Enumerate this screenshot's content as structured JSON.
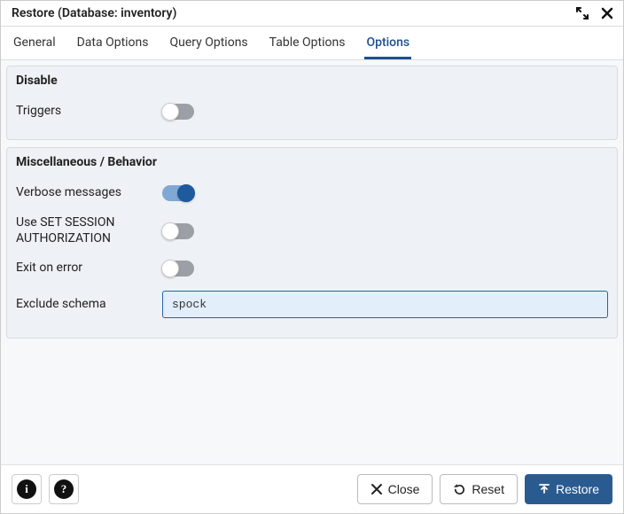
{
  "dialog": {
    "title": "Restore (Database: inventory)"
  },
  "tabs": {
    "items": [
      "General",
      "Data Options",
      "Query Options",
      "Table Options",
      "Options"
    ],
    "active_index": 4
  },
  "sections": {
    "disable": {
      "title": "Disable",
      "triggers": {
        "label": "Triggers",
        "on": false
      }
    },
    "misc": {
      "title": "Miscellaneous / Behavior",
      "verbose": {
        "label": "Verbose messages",
        "on": true
      },
      "set_session_auth": {
        "label": "Use SET SESSION AUTHORIZATION",
        "on": false
      },
      "exit_on_error": {
        "label": "Exit on error",
        "on": false
      },
      "exclude_schema": {
        "label": "Exclude schema",
        "value": "spock"
      }
    }
  },
  "footer": {
    "close": "Close",
    "reset": "Reset",
    "restore": "Restore"
  }
}
